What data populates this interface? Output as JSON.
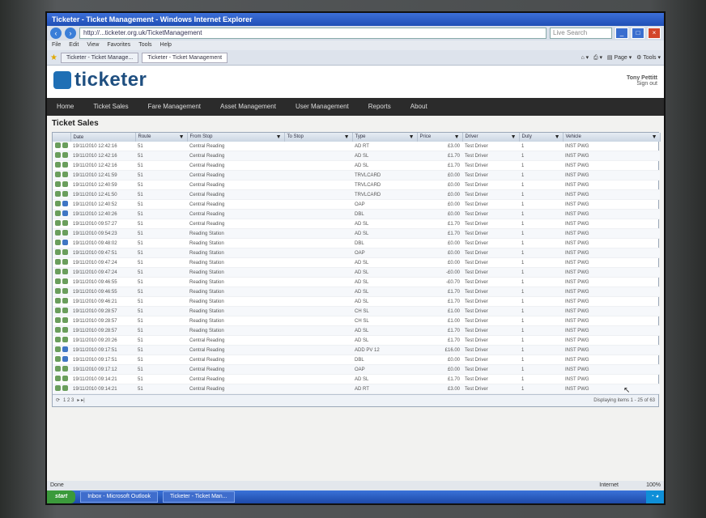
{
  "window": {
    "title": "Ticketer - Ticket Management - Windows Internet Explorer",
    "url": "http://...ticketer.org.uk/TicketManagement",
    "search_placeholder": "Live Search"
  },
  "menu": [
    "File",
    "Edit",
    "View",
    "Favorites",
    "Tools",
    "Help"
  ],
  "tabs": [
    "Ticketer - Ticket Manage...",
    "Ticketer - Ticket Management"
  ],
  "app": {
    "logo": "ticketer",
    "user_name": "Tony Pettitt",
    "user_sub": "Sign out"
  },
  "nav": [
    "Home",
    "Ticket Sales",
    "Fare Management",
    "Asset Management",
    "User Management",
    "Reports",
    "About"
  ],
  "page": {
    "title": "Ticket Sales"
  },
  "table": {
    "columns": [
      "Date",
      "Route",
      "From Stop",
      "To Stop",
      "Type",
      "Price",
      "Driver",
      "Duty",
      "Vehicle"
    ],
    "rows": [
      [
        "19/11/2010 12:42:16",
        "51",
        "Central Reading",
        "",
        "AD RT",
        "£3.00",
        "Test Driver",
        "1",
        "INST PWG",
        "g"
      ],
      [
        "19/11/2010 12:42:16",
        "51",
        "Central Reading",
        "",
        "AD SL",
        "£1.70",
        "Test Driver",
        "1",
        "INST PWG",
        "g"
      ],
      [
        "19/11/2010 12:42:16",
        "51",
        "Central Reading",
        "",
        "AD SL",
        "£1.70",
        "Test Driver",
        "1",
        "INST PWG",
        "g"
      ],
      [
        "19/11/2010 12:41:59",
        "51",
        "Central Reading",
        "",
        "TRVLCARD",
        "£0.00",
        "Test Driver",
        "1",
        "INST PWG",
        "g"
      ],
      [
        "19/11/2010 12:40:59",
        "51",
        "Central Reading",
        "",
        "TRVLCARD",
        "£0.00",
        "Test Driver",
        "1",
        "INST PWG",
        "g"
      ],
      [
        "19/11/2010 12:41:50",
        "51",
        "Central Reading",
        "",
        "TRVLCARD",
        "£0.00",
        "Test Driver",
        "1",
        "INST PWG",
        "g"
      ],
      [
        "19/11/2010 12:40:52",
        "51",
        "Central Reading",
        "",
        "OAP",
        "£0.00",
        "Test Driver",
        "1",
        "INST PWG",
        "b"
      ],
      [
        "19/11/2010 12:40:26",
        "51",
        "Central Reading",
        "",
        "DBL",
        "£0.00",
        "Test Driver",
        "1",
        "INST PWG",
        "b"
      ],
      [
        "19/11/2010 09:57:27",
        "51",
        "Central Reading",
        "",
        "AD SL",
        "£1.70",
        "Test Driver",
        "1",
        "INST PWG",
        "g"
      ],
      [
        "19/11/2010 09:54:23",
        "51",
        "Reading Station",
        "",
        "AD SL",
        "£1.70",
        "Test Driver",
        "1",
        "INST PWG",
        "g"
      ],
      [
        "19/11/2010 09:48:02",
        "51",
        "Reading Station",
        "",
        "DBL",
        "£0.00",
        "Test Driver",
        "1",
        "INST PWG",
        "b"
      ],
      [
        "19/11/2010 09:47:51",
        "51",
        "Reading Station",
        "",
        "OAP",
        "£0.00",
        "Test Driver",
        "1",
        "INST PWG",
        "g"
      ],
      [
        "19/11/2010 09:47:24",
        "51",
        "Reading Station",
        "",
        "AD SL",
        "£0.00",
        "Test Driver",
        "1",
        "INST PWG",
        "g"
      ],
      [
        "19/11/2010 09:47:24",
        "51",
        "Reading Station",
        "",
        "AD SL",
        "-£0.00",
        "Test Driver",
        "1",
        "INST PWG",
        "g"
      ],
      [
        "19/11/2010 09:46:55",
        "51",
        "Reading Station",
        "",
        "AD SL",
        "-£0.70",
        "Test Driver",
        "1",
        "INST PWG",
        "g"
      ],
      [
        "19/11/2010 09:46:55",
        "51",
        "Reading Station",
        "",
        "AD SL",
        "£1.70",
        "Test Driver",
        "1",
        "INST PWG",
        "g"
      ],
      [
        "19/11/2010 09:46:21",
        "51",
        "Reading Station",
        "",
        "AD SL",
        "£1.70",
        "Test Driver",
        "1",
        "INST PWG",
        "g"
      ],
      [
        "19/11/2010 09:28:57",
        "51",
        "Reading Station",
        "",
        "CH SL",
        "£1.00",
        "Test Driver",
        "1",
        "INST PWG",
        "g"
      ],
      [
        "19/11/2010 09:28:57",
        "51",
        "Reading Station",
        "",
        "CH SL",
        "£1.00",
        "Test Driver",
        "1",
        "INST PWG",
        "g"
      ],
      [
        "19/11/2010 09:28:57",
        "51",
        "Reading Station",
        "",
        "AD SL",
        "£1.70",
        "Test Driver",
        "1",
        "INST PWG",
        "g"
      ],
      [
        "19/11/2010 09:20:26",
        "51",
        "Central Reading",
        "",
        "AD SL",
        "£1.70",
        "Test Driver",
        "1",
        "INST PWG",
        "g"
      ],
      [
        "19/11/2010 09:17:51",
        "51",
        "Central Reading",
        "",
        "ADD PV 12",
        "£16.00",
        "Test Driver",
        "1",
        "INST PWG",
        "b"
      ],
      [
        "19/11/2010 09:17:51",
        "51",
        "Central Reading",
        "",
        "DBL",
        "£0.00",
        "Test Driver",
        "1",
        "INST PWG",
        "b"
      ],
      [
        "19/11/2010 09:17:12",
        "51",
        "Central Reading",
        "",
        "OAP",
        "£0.00",
        "Test Driver",
        "1",
        "INST PWG",
        "g"
      ],
      [
        "19/11/2010 09:14:21",
        "51",
        "Central Reading",
        "",
        "AD SL",
        "£1.70",
        "Test Driver",
        "1",
        "INST PWG",
        "g"
      ],
      [
        "19/11/2010 09:14:21",
        "51",
        "Central Reading",
        "",
        "AD RT",
        "£3.00",
        "Test Driver",
        "1",
        "INST PWG",
        "g"
      ]
    ]
  },
  "pager": {
    "pages": "1 2 3",
    "status": "Displaying items 1 - 25 of 63"
  },
  "status_bar": {
    "text": "Done",
    "zone": "Internet",
    "zoom": "100%"
  },
  "taskbar": {
    "start": "start",
    "tasks": [
      "Inbox - Microsoft Outlook",
      "Ticketer - Ticket Man..."
    ]
  }
}
